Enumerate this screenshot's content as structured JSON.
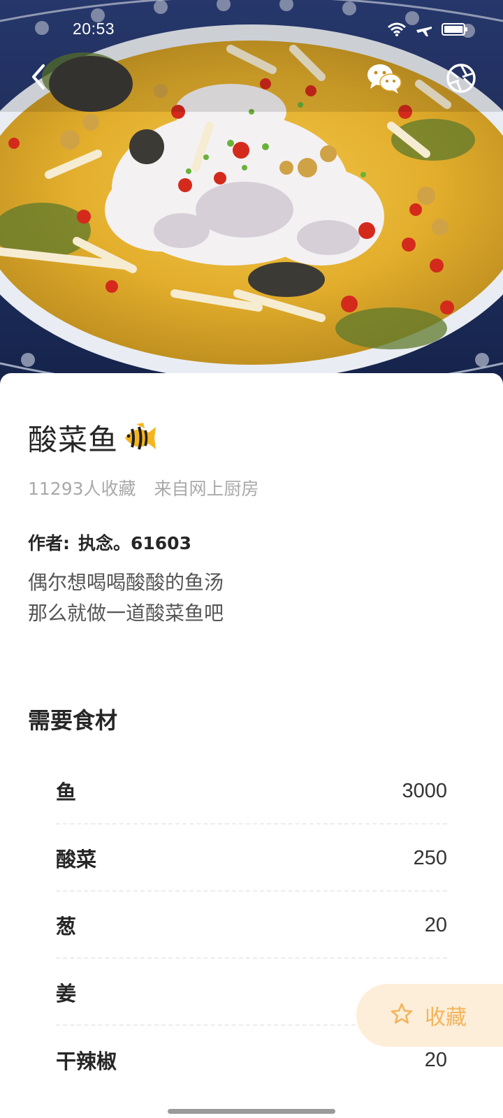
{
  "status_bar": {
    "time": "20:53"
  },
  "nav": {
    "back_icon": "chevron-left-icon",
    "share_icon": "wechat-icon",
    "camera_icon": "camera-shutter-icon"
  },
  "recipe": {
    "title": "酸菜鱼",
    "title_emoji": "tropical-fish-icon",
    "favorites_text": "11293人收藏",
    "source_text": "来自网上厨房",
    "author_label": "作者:",
    "author_name": "执念。61603",
    "description_lines": [
      "偶尔想喝喝酸酸的鱼汤",
      "那么就做一道酸菜鱼吧"
    ]
  },
  "ingredients_section": {
    "title": "需要食材",
    "items": [
      {
        "name": "鱼",
        "qty": "3000"
      },
      {
        "name": "酸菜",
        "qty": "250"
      },
      {
        "name": "葱",
        "qty": "20"
      },
      {
        "name": "姜",
        "qty": ""
      },
      {
        "name": "干辣椒",
        "qty": "20"
      }
    ]
  },
  "collect_button": {
    "label": "收藏",
    "icon": "star-outline-icon"
  },
  "colors": {
    "accent": "#f2b45c",
    "accent_bg": "#fdeed9",
    "text_primary": "#262626",
    "text_secondary": "#a9a9a9"
  }
}
